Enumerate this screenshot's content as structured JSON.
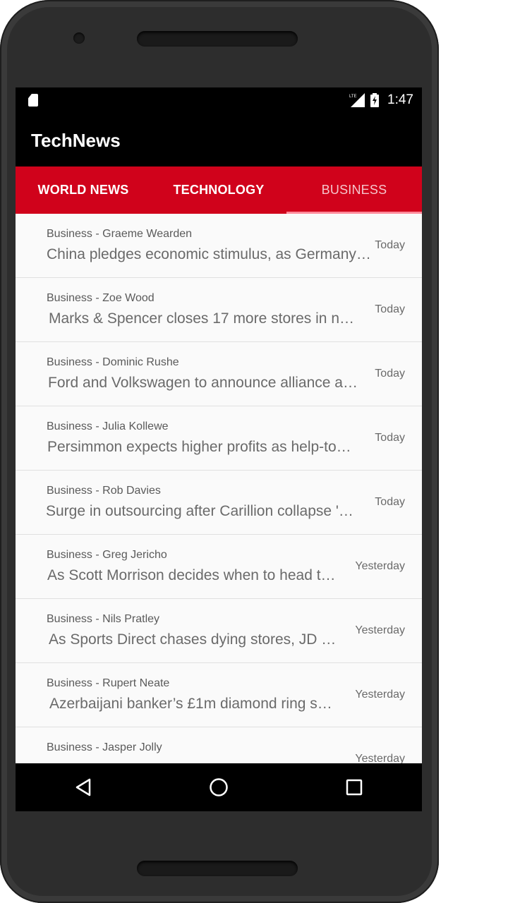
{
  "app": {
    "title": "TechNews"
  },
  "status_bar": {
    "time": "1:47",
    "network": "LTE"
  },
  "tabs": [
    {
      "label": "WORLD NEWS",
      "active": false
    },
    {
      "label": "TECHNOLOGY",
      "active": false
    },
    {
      "label": "BUSINESS",
      "active": true
    }
  ],
  "articles": [
    {
      "meta": "Business - Graeme Wearden",
      "headline": "China pledges economic stimulus, as Germany…",
      "date": "Today"
    },
    {
      "meta": "Business - Zoe Wood",
      "headline": "Marks & Spencer closes 17 more stores in n…",
      "date": "Today"
    },
    {
      "meta": "Business - Dominic Rushe",
      "headline": "Ford and Volkswagen to announce alliance a…",
      "date": "Today"
    },
    {
      "meta": "Business - Julia Kollewe",
      "headline": "Persimmon expects higher profits as help-to…",
      "date": "Today"
    },
    {
      "meta": "Business - Rob Davies",
      "headline": "Surge in outsourcing after Carillion collapse '…",
      "date": "Today"
    },
    {
      "meta": "Business - Greg Jericho",
      "headline": "As Scott Morrison decides when to head t…",
      "date": "Yesterday"
    },
    {
      "meta": "Business - Nils Pratley",
      "headline": "As Sports Direct chases dying stores, JD …",
      "date": "Yesterday"
    },
    {
      "meta": "Business - Rupert Neate",
      "headline": "Azerbaijani banker’s £1m diamond ring s…",
      "date": "Yesterday"
    },
    {
      "meta": "Business - Jasper Jolly",
      "headline": "",
      "date": "Yesterday"
    }
  ],
  "colors": {
    "tab_bar": "#d0021b",
    "app_bar": "#000000",
    "list_bg": "#fafafa"
  },
  "icons": {
    "status_left": "sd-card-icon",
    "status_signal": "lte-signal-icon",
    "status_battery": "battery-charging-icon",
    "nav_back": "back-triangle-icon",
    "nav_home": "home-circle-icon",
    "nav_recents": "recents-square-icon"
  }
}
